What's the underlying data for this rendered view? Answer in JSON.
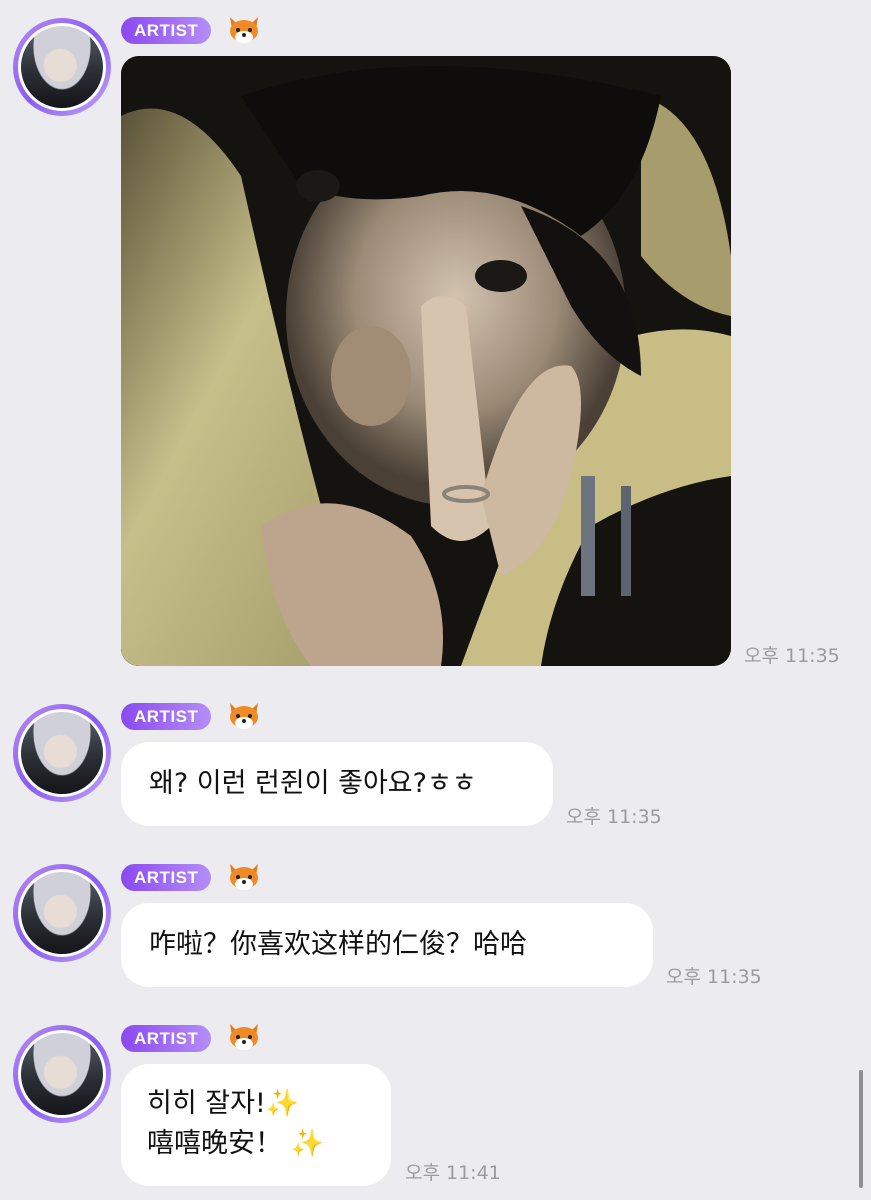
{
  "colors": {
    "background": "#ececf0",
    "badge_start": "#8b49f0",
    "badge_end": "#b58ef8",
    "bubble": "#ffffff",
    "timestamp": "#9a9aa0"
  },
  "messages": [
    {
      "badge": "ARTIST",
      "emoji": "fox-icon",
      "type": "image",
      "image": "selfie-photo",
      "time": "오후 11:35"
    },
    {
      "badge": "ARTIST",
      "emoji": "fox-icon",
      "type": "text",
      "text": "왜? 이런 런쥔이 좋아요?ㅎㅎ",
      "time": "오후 11:35"
    },
    {
      "badge": "ARTIST",
      "emoji": "fox-icon",
      "type": "text",
      "text": "咋啦？你喜欢这样的仁俊？哈哈",
      "time": "오후 11:35"
    },
    {
      "badge": "ARTIST",
      "emoji": "fox-icon",
      "type": "text",
      "line1": "히히 잘자!✨",
      "line2": "嘻嘻晚安！ ✨",
      "time": "오후 11:41"
    }
  ]
}
